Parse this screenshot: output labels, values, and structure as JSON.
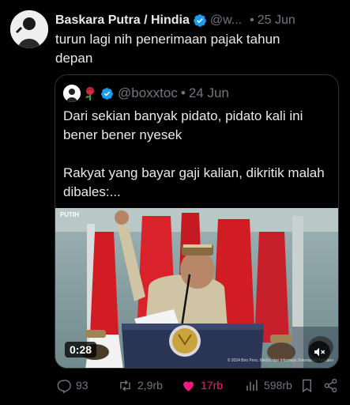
{
  "author": {
    "name": "Baskara Putra / Hindia",
    "handle": "@w...",
    "separator": "•",
    "date": "25 Jun",
    "text": "turun lagi nih penerimaan pajak tahun depan"
  },
  "quoted": {
    "handle": "@boxxtoc",
    "separator": "•",
    "date": "24 Jun",
    "paragraph_1": "Dari sekian banyak pidato, pidato kali ini bener bener nyesek",
    "paragraph_2": "Rakyat yang bayar gaji kalian, dikritik malah dibales:...",
    "video": {
      "duration": "0:28",
      "watermark": "PUTIH",
      "credit": "© 2024 Biro Pers, Media, dan Informasi Sekretariat Presiden"
    }
  },
  "actions": {
    "replies": "93",
    "reposts": "2,9rb",
    "likes": "17rb",
    "views": "598rb"
  },
  "colors": {
    "background": "#000000",
    "text": "#e7e9ea",
    "muted": "#71767b",
    "verified": "#1d9bf0",
    "like_active": "#f91880",
    "border": "#2f3336"
  },
  "icons": {
    "verified": "verified-badge-icon",
    "reply": "reply-icon",
    "repost": "repost-icon",
    "like": "heart-filled-icon",
    "views": "views-icon",
    "bookmark": "bookmark-icon",
    "share": "share-icon",
    "mute": "volume-muted-icon"
  }
}
